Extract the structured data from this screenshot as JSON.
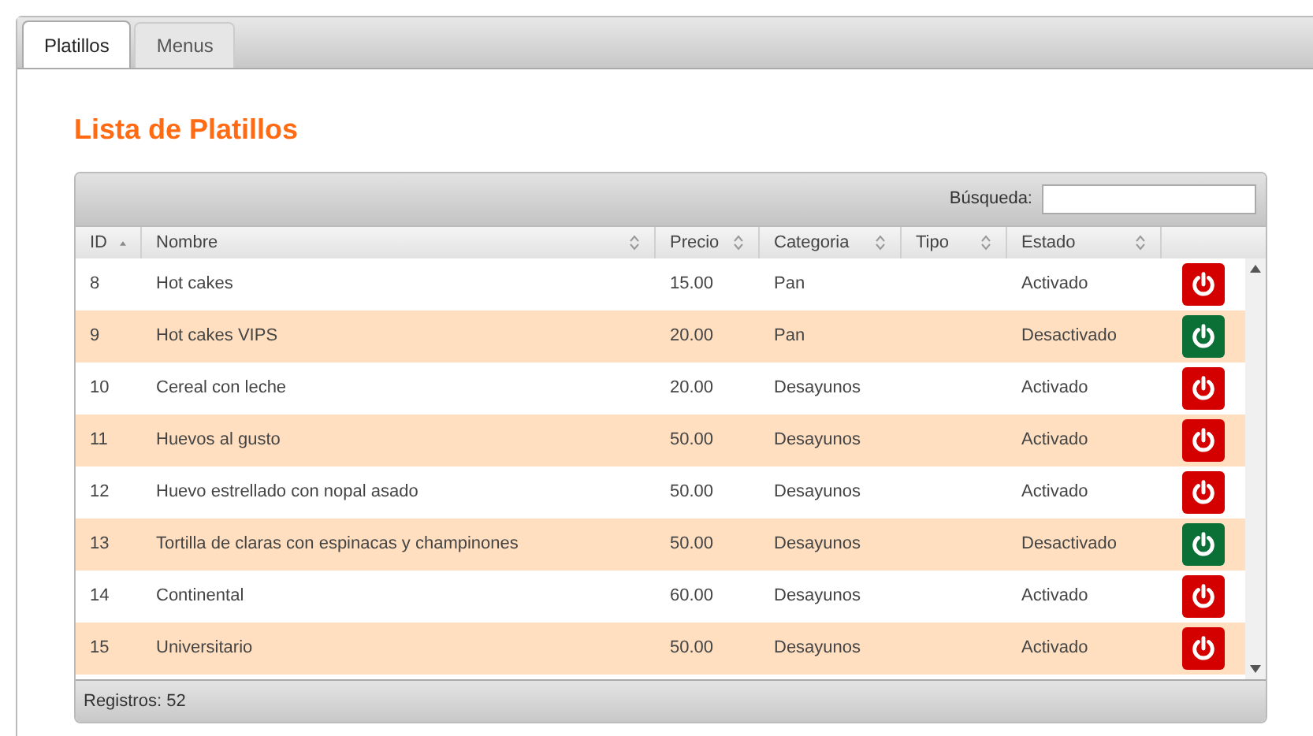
{
  "tabs": [
    {
      "label": "Platillos",
      "selected": true
    },
    {
      "label": "Menus",
      "selected": false
    }
  ],
  "title": "Lista de Platillos",
  "search": {
    "label": "Búsqueda:"
  },
  "table": {
    "columns": [
      {
        "label": "ID",
        "sorted": true
      },
      {
        "label": "Nombre",
        "sorted": false
      },
      {
        "label": "Precio",
        "sorted": false
      },
      {
        "label": "Categoria",
        "sorted": false
      },
      {
        "label": "Tipo",
        "sorted": false
      },
      {
        "label": "Estado",
        "sorted": false
      }
    ],
    "rows": [
      {
        "id": "8",
        "name": "Hot cakes",
        "price": "15.00",
        "category": "Pan",
        "status": "Activado",
        "active": true
      },
      {
        "id": "9",
        "name": "Hot cakes VIPS",
        "price": "20.00",
        "category": "Pan",
        "status": "Desactivado",
        "active": false
      },
      {
        "id": "10",
        "name": "Cereal con leche",
        "price": "20.00",
        "category": "Desayunos",
        "status": "Activado",
        "active": true
      },
      {
        "id": "11",
        "name": "Huevos al gusto",
        "price": "50.00",
        "category": "Desayunos",
        "status": "Activado",
        "active": true
      },
      {
        "id": "12",
        "name": "Huevo estrellado con nopal asado",
        "price": "50.00",
        "category": "Desayunos",
        "status": "Activado",
        "active": true
      },
      {
        "id": "13",
        "name": "Tortilla de claras con espinacas y champinones",
        "price": "50.00",
        "category": "Desayunos",
        "status": "Desactivado",
        "active": false
      },
      {
        "id": "14",
        "name": "Continental",
        "price": "60.00",
        "category": "Desayunos",
        "status": "Activado",
        "active": true
      },
      {
        "id": "15",
        "name": "Universitario",
        "price": "50.00",
        "category": "Desayunos",
        "status": "Activado",
        "active": true
      }
    ]
  },
  "footer": "Registros: 52"
}
